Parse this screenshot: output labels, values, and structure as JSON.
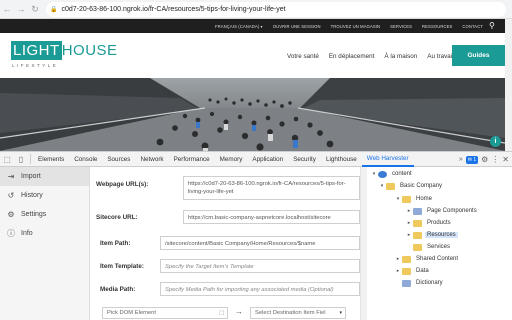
{
  "browser": {
    "url": "c0d7-20-63-86-100.ngrok.io/fr-CA/resources/5-tips-for-living-your-life-yet"
  },
  "site": {
    "topnav": [
      "FRANÇAIS (CANADA) ▾",
      "OUVRIR UNE SESSION",
      "TROUVEZ UN MAGASIN",
      "SERVICES",
      "RESSOURCES",
      "CONTACT"
    ],
    "logo_highlight": "LIGHT",
    "logo_rest": "HOUSE",
    "logo_sub": "LIFESTYLE",
    "nav": [
      "Votre santé",
      "En déplacement",
      "À la maison",
      "Au travail"
    ],
    "guides_label": "Guides",
    "hero_badge": "i"
  },
  "devtools": {
    "tabs": [
      "Elements",
      "Console",
      "Sources",
      "Network",
      "Performance",
      "Memory",
      "Application",
      "Security",
      "Lighthouse",
      "Web Harvester"
    ],
    "active_tab": "Web Harvester",
    "message_count": "1"
  },
  "harvester": {
    "menu": [
      {
        "label": "Import",
        "icon": "import-icon"
      },
      {
        "label": "History",
        "icon": "history-icon"
      },
      {
        "label": "Settings",
        "icon": "settings-icon"
      },
      {
        "label": "Info",
        "icon": "info-icon"
      }
    ],
    "form": {
      "webpage_url_label": "Webpage URL(s):",
      "webpage_url_value": "https://c0d7-20-63-86-100.ngrok.io/fr-CA/resources/5-tips-for-living-your-life-yet",
      "sitecore_url_label": "Sitecore URL:",
      "sitecore_url_value": "https://cm.basic-company-aspnetcore.localhost/sitecore",
      "item_path_label": "Item Path:",
      "item_path_value": "/sitecore/content/Basic Company/Home/Resources/$name",
      "item_template_label": "Item Template:",
      "item_template_placeholder": "Specify the Target Item's Template",
      "media_path_label": "Media Path:",
      "media_path_placeholder": "Specify Media Path for importing any associated media (Optional)",
      "dom_element_placeholder": "Pick DOM Element",
      "destination_placeholder": "Select Destination Item Fiel"
    },
    "tree": [
      {
        "label": "content",
        "icon": "globe",
        "toggle": "▾"
      },
      {
        "label": "Basic Company",
        "icon": "folder",
        "toggle": "▾"
      },
      {
        "label": "Home",
        "icon": "folder",
        "toggle": "▾"
      },
      {
        "label": "Page Components",
        "icon": "doc",
        "toggle": "▸"
      },
      {
        "label": "Products",
        "icon": "folder",
        "toggle": "▸"
      },
      {
        "label": "Resources",
        "icon": "folder",
        "toggle": "▸",
        "selected": true
      },
      {
        "label": "Services",
        "icon": "folder",
        "toggle": ""
      },
      {
        "label": "Shared Content",
        "icon": "folder",
        "toggle": "▸"
      },
      {
        "label": "Data",
        "icon": "folder",
        "toggle": "▸"
      },
      {
        "label": "Dictionary",
        "icon": "doc",
        "toggle": ""
      }
    ]
  },
  "colors": {
    "brand_teal": "#1b9b96",
    "devtools_accent": "#1a73e8",
    "topnav_bg": "#1f1f1f",
    "tree_selected": "#d6e4fa"
  }
}
